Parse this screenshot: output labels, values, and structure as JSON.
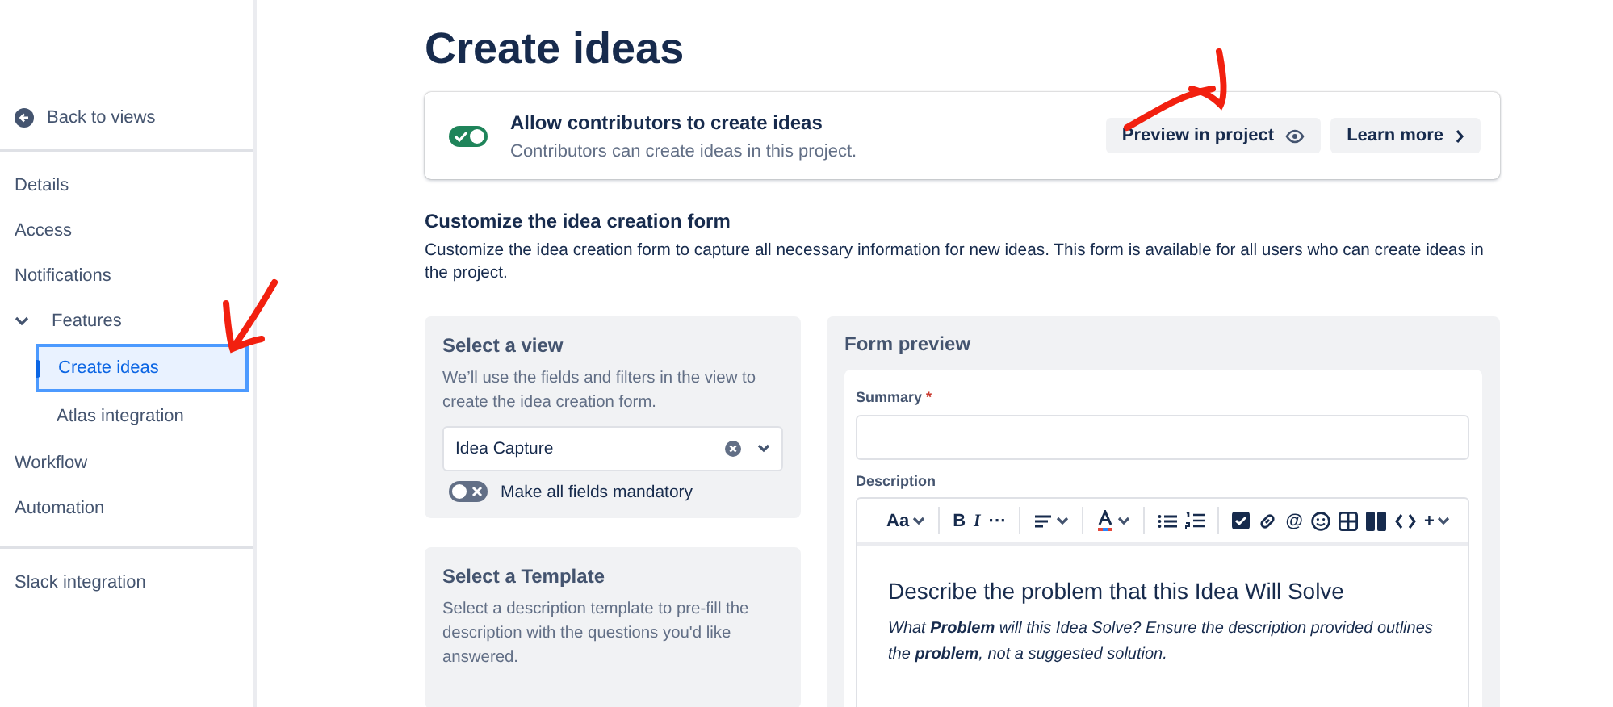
{
  "sidebar": {
    "back": "Back to views",
    "groups": [
      [
        {
          "label": "Details",
          "selected": false
        },
        {
          "label": "Access",
          "selected": false
        },
        {
          "label": "Notifications",
          "selected": false
        },
        {
          "label": "Features",
          "selected": false,
          "expanded": true,
          "children": [
            {
              "label": "Create ideas",
              "selected": true
            },
            {
              "label": "Atlas integration",
              "selected": false
            }
          ]
        },
        {
          "label": "Workflow",
          "selected": false
        },
        {
          "label": "Automation",
          "selected": false
        }
      ],
      [
        {
          "label": "Slack integration",
          "selected": false
        }
      ]
    ]
  },
  "page_title": "Create ideas",
  "contributors": {
    "title": "Allow contributors to create ideas",
    "subtitle": "Contributors can create ideas in this project.",
    "on": true,
    "buttons": [
      {
        "label": "Preview in project",
        "kind": "eye"
      },
      {
        "label": "Learn more",
        "kind": "chevron"
      }
    ]
  },
  "customize": {
    "title": "Customize the idea creation form",
    "text": "Customize the idea creation form to capture all necessary information for new ideas. This form is available for all users who can create ideas in the project."
  },
  "view_panel": {
    "title": "Select a view",
    "text": "We’ll use the fields and filters in the view to create the idea creation form.",
    "select_value": "Idea Capture",
    "mandatory": {
      "label": "Make all fields mandatory",
      "on": false
    }
  },
  "template_panel": {
    "title": "Select a Template",
    "text": "Select a description template to pre-fill the description with the questions you'd like answered."
  },
  "form_preview": {
    "title": "Form preview",
    "summary_label": "Summary",
    "required_mark": "*",
    "description_label": "Description",
    "toolbar": [
      [
        {
          "kind": "glyph",
          "text": "Aa",
          "menu": true
        }
      ],
      [
        {
          "kind": "glyph",
          "text": "B"
        },
        {
          "kind": "glyph",
          "text": "I",
          "italic": true
        },
        {
          "kind": "glyph",
          "text": "···"
        }
      ],
      [
        {
          "kind": "align",
          "menu": true
        }
      ],
      [
        {
          "kind": "color",
          "menu": true
        }
      ],
      [
        {
          "kind": "bullets"
        },
        {
          "kind": "numbers"
        }
      ],
      [
        {
          "kind": "checkbox"
        },
        {
          "kind": "link"
        },
        {
          "kind": "glyph",
          "text": "@"
        },
        {
          "kind": "emoji"
        },
        {
          "kind": "table"
        },
        {
          "kind": "layout"
        },
        {
          "kind": "code"
        },
        {
          "kind": "glyph",
          "text": "+",
          "menu": true
        }
      ]
    ],
    "heading": "Describe the problem that this Idea Will Solve",
    "body": "What **Problem** will this Idea Solve? Ensure the description provided outlines the **problem**, not a suggested solution."
  }
}
